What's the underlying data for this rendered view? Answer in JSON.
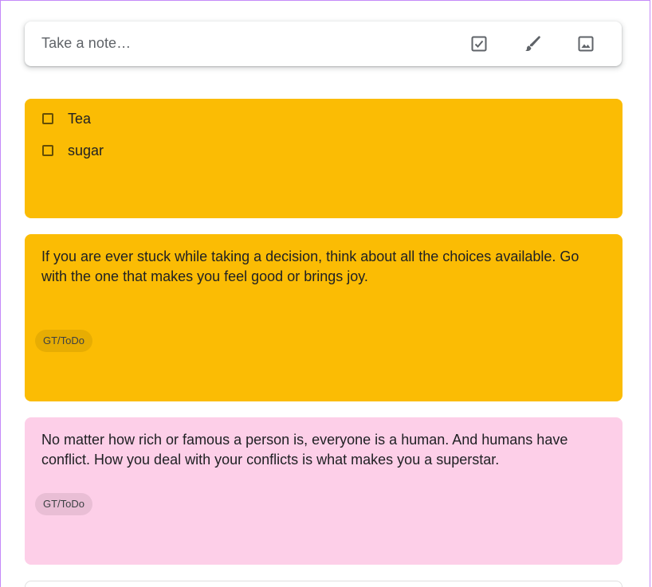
{
  "composer": {
    "placeholder": "Take a note…",
    "icons": [
      "checkbox-icon",
      "brush-icon",
      "image-icon"
    ]
  },
  "notes": [
    {
      "color": "#fbbc04",
      "type": "checklist",
      "items": [
        {
          "label": "Tea",
          "checked": false
        },
        {
          "label": "sugar",
          "checked": false
        }
      ]
    },
    {
      "color": "#fbbc04",
      "type": "text",
      "text": "If you are ever stuck while taking a decision, think about all the choices available. Go with the one that makes you feel good or brings joy.",
      "label": "GT/ToDo"
    },
    {
      "color": "#fdcfe8",
      "type": "text",
      "text": "No matter how rich or famous a person is, everyone is a human. And humans have conflict. How you deal with your conflicts is what makes you a superstar.",
      "label": "GT/ToDo"
    }
  ]
}
